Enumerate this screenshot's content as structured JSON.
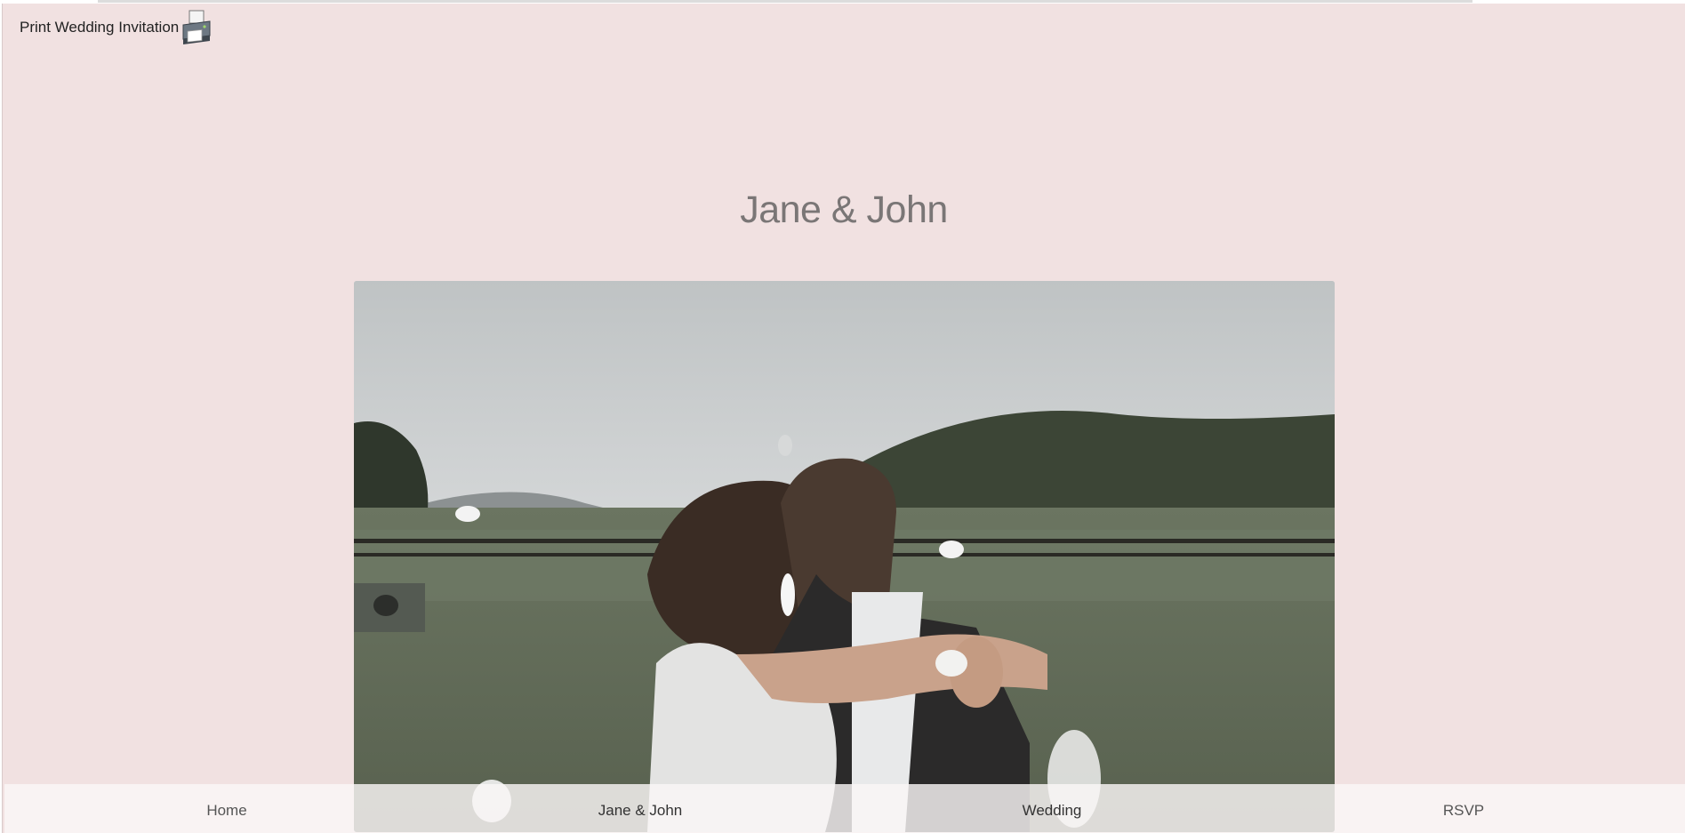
{
  "print_link": {
    "label": "Print Wedding Invitation",
    "icon": "printer-icon"
  },
  "hero": {
    "title": "Jane & John"
  },
  "nav": {
    "items": [
      {
        "label": "Home"
      },
      {
        "label": "Jane & John"
      },
      {
        "label": "Wedding"
      },
      {
        "label": "RSVP"
      }
    ]
  },
  "colors": {
    "page_background": "#f1e1e1",
    "title_text": "#7a7676",
    "nav_background": "#faf7f7"
  }
}
